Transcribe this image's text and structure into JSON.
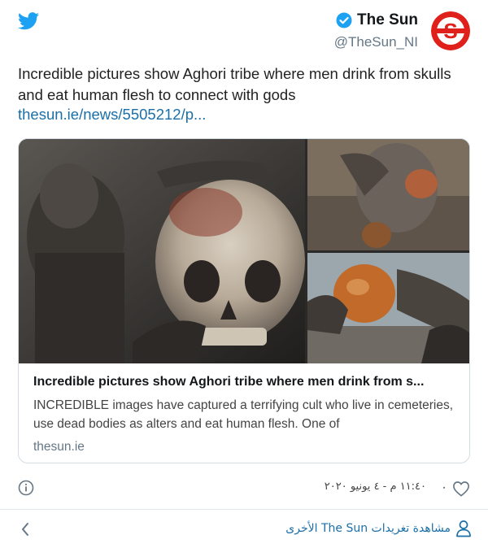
{
  "author": {
    "display_name": "The Sun",
    "handle": "@TheSun_NI",
    "avatar_letter": "S"
  },
  "tweet": {
    "text": "Incredible pictures show Aghori tribe where men drink from skulls and eat human flesh to connect with gods",
    "link_text": "thesun.ie/news/5505212/p..."
  },
  "card": {
    "title": "Incredible pictures show Aghori tribe where men drink from s...",
    "description": "INCREDIBLE images have captured a terrifying cult who live in cemeteries, use dead bodies as alters and eat human flesh. One of",
    "domain": "thesun.ie"
  },
  "footer": {
    "likes": "٠",
    "timestamp": "١١:٤٠ م - ٤ يونيو ٢٠٢٠"
  },
  "bottom_bar": {
    "more_tweets_label": "مشاهدة تغريدات The Sun الأخرى"
  },
  "icons": {
    "brand": "twitter-bird-icon",
    "verified": "verified-badge-icon",
    "info": "info-icon",
    "like": "heart-icon",
    "profile": "person-icon",
    "back": "chevron-left-icon"
  },
  "colors": {
    "twitter_blue": "#1da1f2",
    "link_blue": "#1b6fa8",
    "sun_red": "#e0201b"
  }
}
